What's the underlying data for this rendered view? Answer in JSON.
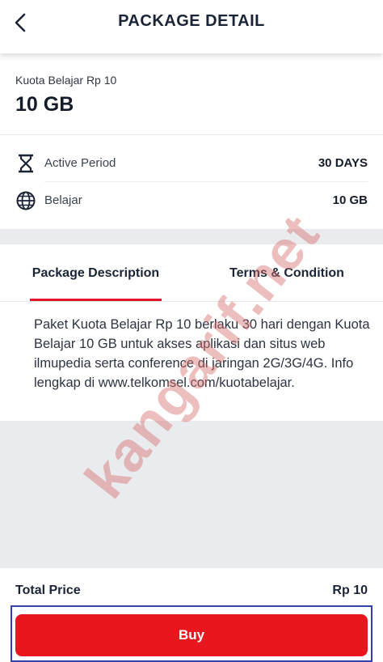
{
  "header": {
    "title": "PACKAGE DETAIL",
    "back_icon": "chevron-left-icon"
  },
  "package": {
    "name": "Kuota Belajar Rp 10",
    "size": "10 GB"
  },
  "details": [
    {
      "icon": "hourglass-icon",
      "label": "Active Period",
      "value": "30 DAYS"
    },
    {
      "icon": "globe-icon",
      "label": "Belajar",
      "value": "10 GB"
    }
  ],
  "tabs": [
    {
      "label": "Package Description",
      "active": true
    },
    {
      "label": "Terms & Condition",
      "active": false
    }
  ],
  "description": "Paket Kuota Belajar Rp 10 berlaku 30 hari dengan Kuota Belajar 10 GB untuk akses aplikasi dan situs web ilmupedia serta conference di jaringan 2G/3G/4G. Info lengkap di www.telkomsel.com/kuotabelajar.",
  "footer": {
    "total_label": "Total Price",
    "total_value": "Rp 10",
    "buy_label": "Buy"
  },
  "watermark": "kangarif.net",
  "colors": {
    "accent": "#e2162b",
    "button": "#e8161f",
    "divider_gray": "#e9ebef",
    "frame": "#3443a8"
  }
}
